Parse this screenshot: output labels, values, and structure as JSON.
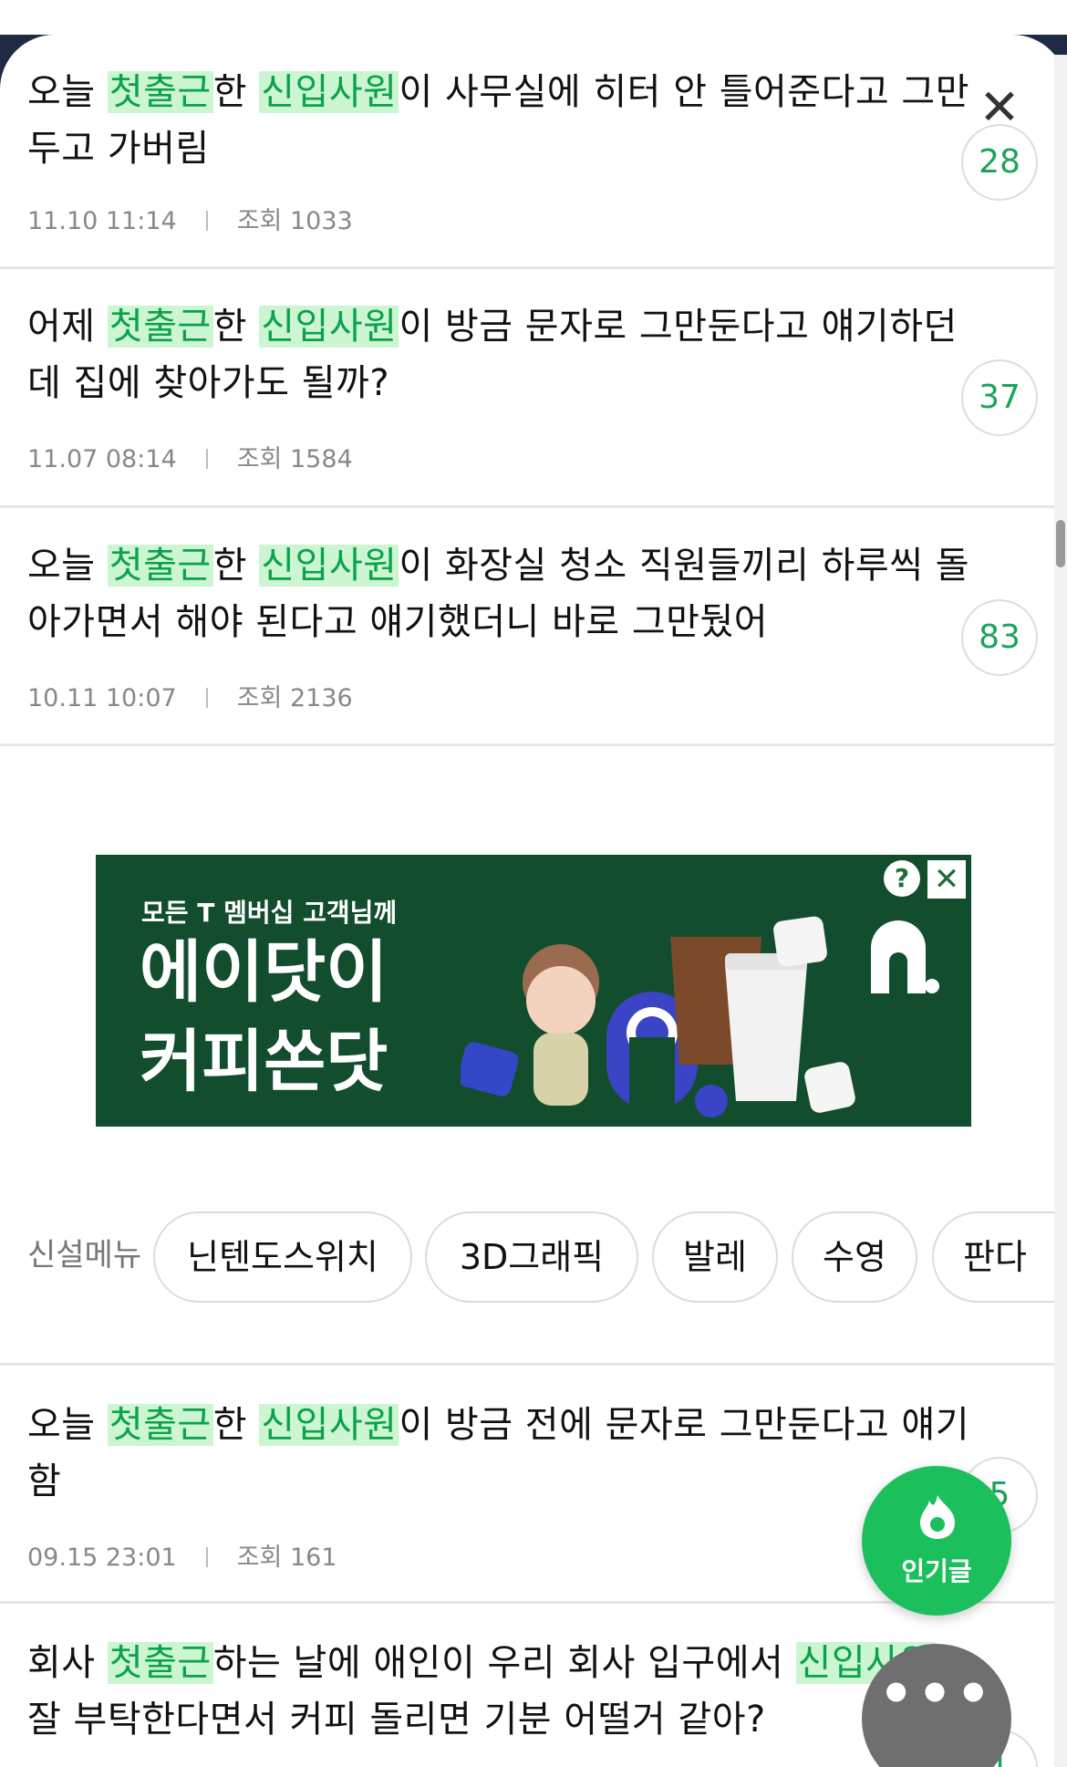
{
  "posts": [
    {
      "title_parts": [
        "오늘 ",
        "첫출근",
        "한 ",
        "신입사원",
        "이 사무실에 히터 안 틀어준다고 그만",
        "두고 가버림"
      ],
      "date": "11.10 11:14",
      "views_label": "조회",
      "views": "1033",
      "comments": "28"
    },
    {
      "title_parts": [
        "어제 ",
        "첫출근",
        "한 ",
        "신입사원",
        "이 방금 문자로 그만둔다고 얘기하던",
        "데 집에 찾아가도 될까?"
      ],
      "date": "11.07 08:14",
      "views_label": "조회",
      "views": "1584",
      "comments": "37"
    },
    {
      "title_parts": [
        "오늘 ",
        "첫출근",
        "한 ",
        "신입사원",
        "이 화장실 청소 직원들끼리 하루씩 돌",
        "아가면서 해야 된다고 얘기했더니 바로 그만뒀어"
      ],
      "date": "10.11 10:07",
      "views_label": "조회",
      "views": "2136",
      "comments": "83"
    },
    {
      "title_parts": [
        "오늘 ",
        "첫출근",
        "한 ",
        "신입사원",
        "이 방금 전에 문자로 그만둔다고 얘기",
        "함"
      ],
      "date": "09.15 23:01",
      "views_label": "조회",
      "views": "161",
      "comments": "5"
    },
    {
      "title_parts": [
        "회사 ",
        "첫출근",
        "하는 날에 애인이 우리 회사 입구에서 ",
        "신입사원",
        "",
        "잘 부탁한다면서 커피 돌리면 기분 어떨거 같아?"
      ],
      "comments": "1"
    }
  ],
  "ad": {
    "subtitle": "모든 T 멤버십 고객님께",
    "headline_line1": "에이닷이",
    "headline_line2": "커피쏜닷",
    "help_label": "?",
    "close_label": "✕",
    "brand_color": "#124d2e"
  },
  "menu": {
    "label": "신설메뉴",
    "chips": [
      "닌텐도스위치",
      "3D그래픽",
      "발레",
      "수영",
      "판다"
    ]
  },
  "fab": {
    "popular_label": "인기글",
    "more_label": "•••"
  },
  "close_label": "✕",
  "colors": {
    "accent": "#1bbf5b",
    "highlight_bg": "#ccf5d2",
    "highlight_text": "#0aa24b"
  },
  "icons": {
    "fab": "flame-icon",
    "close": "close-icon",
    "more": "more-dots-icon"
  }
}
